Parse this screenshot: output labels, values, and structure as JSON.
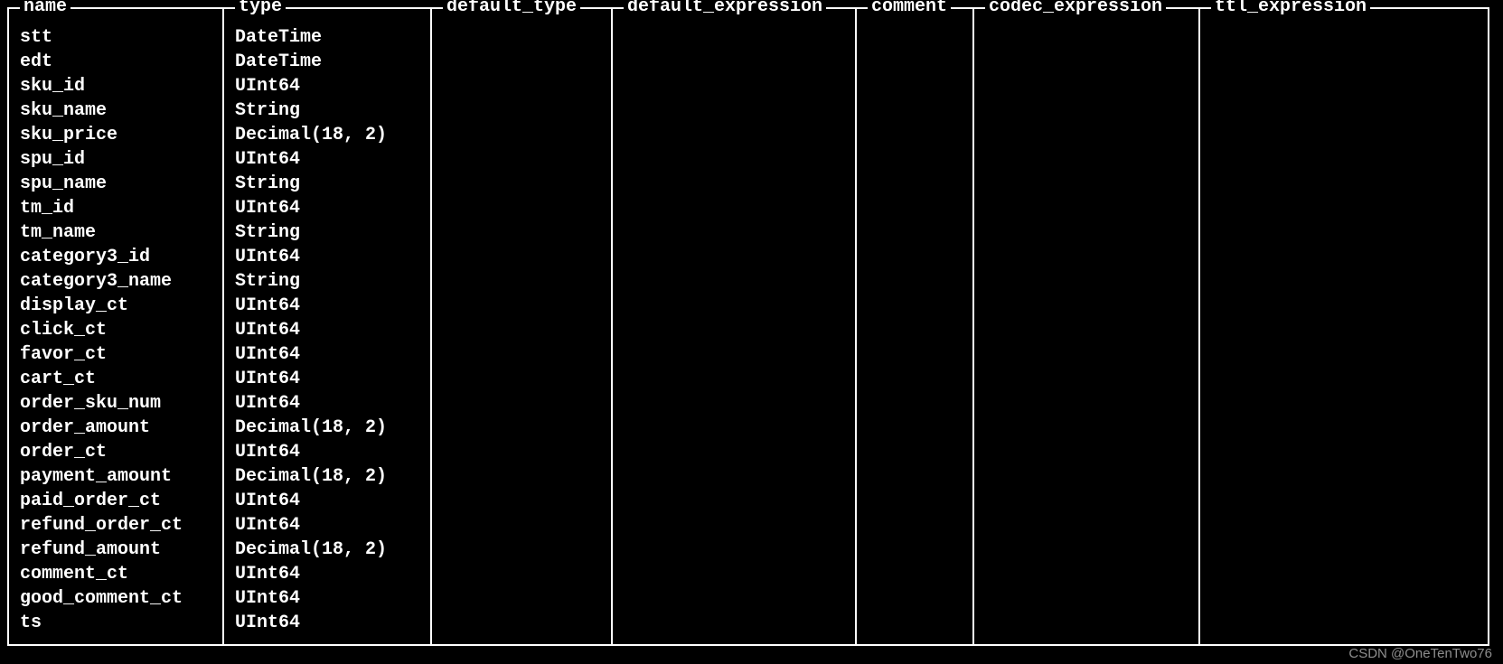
{
  "table": {
    "columns": [
      {
        "key": "name",
        "header": "name",
        "cssClass": "col-name"
      },
      {
        "key": "type",
        "header": "type",
        "cssClass": "col-type"
      },
      {
        "key": "default_type",
        "header": "default_type",
        "cssClass": "col-default-type"
      },
      {
        "key": "default_expression",
        "header": "default_expression",
        "cssClass": "col-default-expression"
      },
      {
        "key": "comment",
        "header": "comment",
        "cssClass": "col-comment"
      },
      {
        "key": "codec_expression",
        "header": "codec_expression",
        "cssClass": "col-codec-expression"
      },
      {
        "key": "ttl_expression",
        "header": "ttl_expression",
        "cssClass": "col-ttl-expression"
      }
    ],
    "rows": [
      {
        "name": "stt",
        "type": "DateTime",
        "default_type": "",
        "default_expression": "",
        "comment": "",
        "codec_expression": "",
        "ttl_expression": ""
      },
      {
        "name": "edt",
        "type": "DateTime",
        "default_type": "",
        "default_expression": "",
        "comment": "",
        "codec_expression": "",
        "ttl_expression": ""
      },
      {
        "name": "sku_id",
        "type": "UInt64",
        "default_type": "",
        "default_expression": "",
        "comment": "",
        "codec_expression": "",
        "ttl_expression": ""
      },
      {
        "name": "sku_name",
        "type": "String",
        "default_type": "",
        "default_expression": "",
        "comment": "",
        "codec_expression": "",
        "ttl_expression": ""
      },
      {
        "name": "sku_price",
        "type": "Decimal(18, 2)",
        "default_type": "",
        "default_expression": "",
        "comment": "",
        "codec_expression": "",
        "ttl_expression": ""
      },
      {
        "name": "spu_id",
        "type": "UInt64",
        "default_type": "",
        "default_expression": "",
        "comment": "",
        "codec_expression": "",
        "ttl_expression": ""
      },
      {
        "name": "spu_name",
        "type": "String",
        "default_type": "",
        "default_expression": "",
        "comment": "",
        "codec_expression": "",
        "ttl_expression": ""
      },
      {
        "name": "tm_id",
        "type": "UInt64",
        "default_type": "",
        "default_expression": "",
        "comment": "",
        "codec_expression": "",
        "ttl_expression": ""
      },
      {
        "name": "tm_name",
        "type": "String",
        "default_type": "",
        "default_expression": "",
        "comment": "",
        "codec_expression": "",
        "ttl_expression": ""
      },
      {
        "name": "category3_id",
        "type": "UInt64",
        "default_type": "",
        "default_expression": "",
        "comment": "",
        "codec_expression": "",
        "ttl_expression": ""
      },
      {
        "name": "category3_name",
        "type": "String",
        "default_type": "",
        "default_expression": "",
        "comment": "",
        "codec_expression": "",
        "ttl_expression": ""
      },
      {
        "name": "display_ct",
        "type": "UInt64",
        "default_type": "",
        "default_expression": "",
        "comment": "",
        "codec_expression": "",
        "ttl_expression": ""
      },
      {
        "name": "click_ct",
        "type": "UInt64",
        "default_type": "",
        "default_expression": "",
        "comment": "",
        "codec_expression": "",
        "ttl_expression": ""
      },
      {
        "name": "favor_ct",
        "type": "UInt64",
        "default_type": "",
        "default_expression": "",
        "comment": "",
        "codec_expression": "",
        "ttl_expression": ""
      },
      {
        "name": "cart_ct",
        "type": "UInt64",
        "default_type": "",
        "default_expression": "",
        "comment": "",
        "codec_expression": "",
        "ttl_expression": ""
      },
      {
        "name": "order_sku_num",
        "type": "UInt64",
        "default_type": "",
        "default_expression": "",
        "comment": "",
        "codec_expression": "",
        "ttl_expression": ""
      },
      {
        "name": "order_amount",
        "type": "Decimal(18, 2)",
        "default_type": "",
        "default_expression": "",
        "comment": "",
        "codec_expression": "",
        "ttl_expression": ""
      },
      {
        "name": "order_ct",
        "type": "UInt64",
        "default_type": "",
        "default_expression": "",
        "comment": "",
        "codec_expression": "",
        "ttl_expression": ""
      },
      {
        "name": "payment_amount",
        "type": "Decimal(18, 2)",
        "default_type": "",
        "default_expression": "",
        "comment": "",
        "codec_expression": "",
        "ttl_expression": ""
      },
      {
        "name": "paid_order_ct",
        "type": "UInt64",
        "default_type": "",
        "default_expression": "",
        "comment": "",
        "codec_expression": "",
        "ttl_expression": ""
      },
      {
        "name": "refund_order_ct",
        "type": "UInt64",
        "default_type": "",
        "default_expression": "",
        "comment": "",
        "codec_expression": "",
        "ttl_expression": ""
      },
      {
        "name": "refund_amount",
        "type": "Decimal(18, 2)",
        "default_type": "",
        "default_expression": "",
        "comment": "",
        "codec_expression": "",
        "ttl_expression": ""
      },
      {
        "name": "comment_ct",
        "type": "UInt64",
        "default_type": "",
        "default_expression": "",
        "comment": "",
        "codec_expression": "",
        "ttl_expression": ""
      },
      {
        "name": "good_comment_ct",
        "type": "UInt64",
        "default_type": "",
        "default_expression": "",
        "comment": "",
        "codec_expression": "",
        "ttl_expression": ""
      },
      {
        "name": "ts",
        "type": "UInt64",
        "default_type": "",
        "default_expression": "",
        "comment": "",
        "codec_expression": "",
        "ttl_expression": ""
      }
    ]
  },
  "watermark": "CSDN @OneTenTwo76"
}
